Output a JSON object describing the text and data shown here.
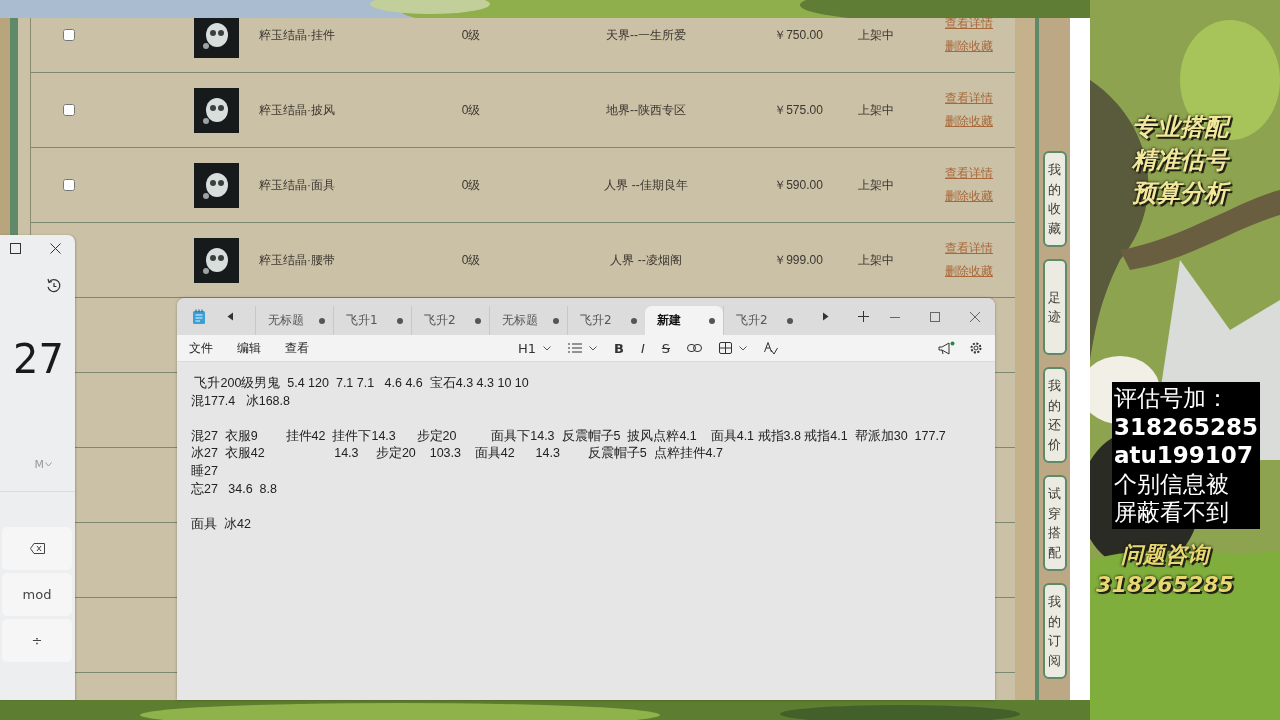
{
  "table_rows": [
    {
      "checked": false,
      "item": "粹玉结晶·挂件",
      "grade": "0级",
      "server": "天界--一生所爱",
      "price": "￥750.00",
      "status": "上架中",
      "links": [
        "查看详情",
        "删除收藏"
      ]
    },
    {
      "checked": false,
      "item": "粹玉结晶·披风",
      "grade": "0级",
      "server": "地界--陕西专区",
      "price": "￥575.00",
      "status": "上架中",
      "links": [
        "查看详情",
        "删除收藏"
      ]
    },
    {
      "checked": false,
      "item": "粹玉结晶·面具",
      "grade": "0级",
      "server": "人界 --佳期良年",
      "price": "￥590.00",
      "status": "上架中",
      "links": [
        "查看详情",
        "删除收藏"
      ]
    },
    {
      "item": "粹玉结晶·腰带",
      "grade": "0级",
      "server": "人界 --凌烟阁",
      "price": "￥999.00",
      "status": "上架中",
      "links": [
        "查看详情",
        "删除收藏"
      ]
    }
  ],
  "side_tabs": [
    "我的收藏",
    "足迹",
    "我的还价",
    "试穿搭配",
    "我的订阅"
  ],
  "promo": {
    "slogans": [
      "专业搭配",
      "精准估号",
      "预算分析"
    ],
    "notice_lines": [
      "评估号加：",
      "318265285",
      "atu199107",
      "个别信息被",
      "屏蔽看不到"
    ],
    "contact_title": "问题咨询",
    "contact_number": "318265285"
  },
  "calculator": {
    "display": "27",
    "memory": "M",
    "keys": [
      "mod",
      "÷"
    ]
  },
  "notepad": {
    "tabs": [
      {
        "label": "无标题",
        "selected": false
      },
      {
        "label": "飞升1",
        "selected": false
      },
      {
        "label": "飞升2",
        "selected": false
      },
      {
        "label": "无标题",
        "selected": false
      },
      {
        "label": "飞升2",
        "selected": false
      },
      {
        "label": "新建",
        "selected": true
      },
      {
        "label": "飞升2",
        "selected": false
      }
    ],
    "menu": [
      "文件",
      "编辑",
      "查看"
    ],
    "toolbar": {
      "heading": "H1",
      "bold": "B",
      "italic": "I",
      "strike": "S"
    },
    "text": " 飞升200级男鬼  5.4 120  7.1 7.1   4.6 4.6  宝石4.3 4.3 10 10\n混177.4   冰168.8\n\n混27  衣服9        挂件42  挂件下14.3      步定20          面具下14.3  反震帽子5  披风点粹4.1    面具4.1 戒指3.8 戒指4.1  帮派加30  177.7\n冰27  衣服42                    14.3     步定20    103.3    面具42      14.3        反震帽子5  点粹挂件4.7\n睡27\n忘27   34.6  8.8\n\n面具  冰42"
  }
}
